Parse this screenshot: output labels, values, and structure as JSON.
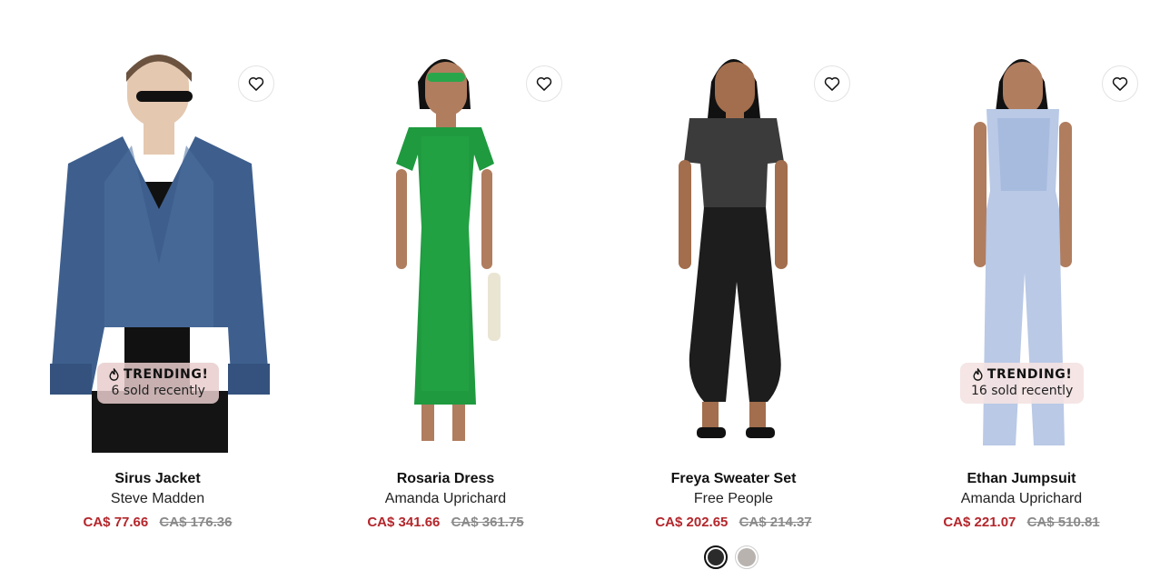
{
  "products": [
    {
      "name": "Sirus Jacket",
      "brand": "Steve Madden",
      "sale_price": "CA$ 77.66",
      "original_price": "CA$ 176.36",
      "badge": {
        "title": "TRENDING!",
        "subtitle": "6 sold recently"
      },
      "wishlist_icon": "heart-outline-icon"
    },
    {
      "name": "Rosaria Dress",
      "brand": "Amanda Uprichard",
      "sale_price": "CA$ 341.66",
      "original_price": "CA$ 361.75",
      "wishlist_icon": "heart-outline-icon"
    },
    {
      "name": "Freya Sweater Set",
      "brand": "Free People",
      "sale_price": "CA$ 202.65",
      "original_price": "CA$ 214.37",
      "wishlist_icon": "heart-outline-icon",
      "swatches": [
        {
          "color": "#2b2b2b",
          "selected": true
        },
        {
          "color": "#b9b3b0",
          "selected": false
        }
      ]
    },
    {
      "name": "Ethan Jumpsuit",
      "brand": "Amanda Uprichard",
      "sale_price": "CA$ 221.07",
      "original_price": "CA$ 510.81",
      "badge": {
        "title": "TRENDING!",
        "subtitle": "16 sold recently"
      },
      "wishlist_icon": "heart-outline-icon"
    }
  ],
  "colors": {
    "sale": "#b3262b",
    "original": "#8a8a8a",
    "badge_bg": "#ecd3d3"
  }
}
